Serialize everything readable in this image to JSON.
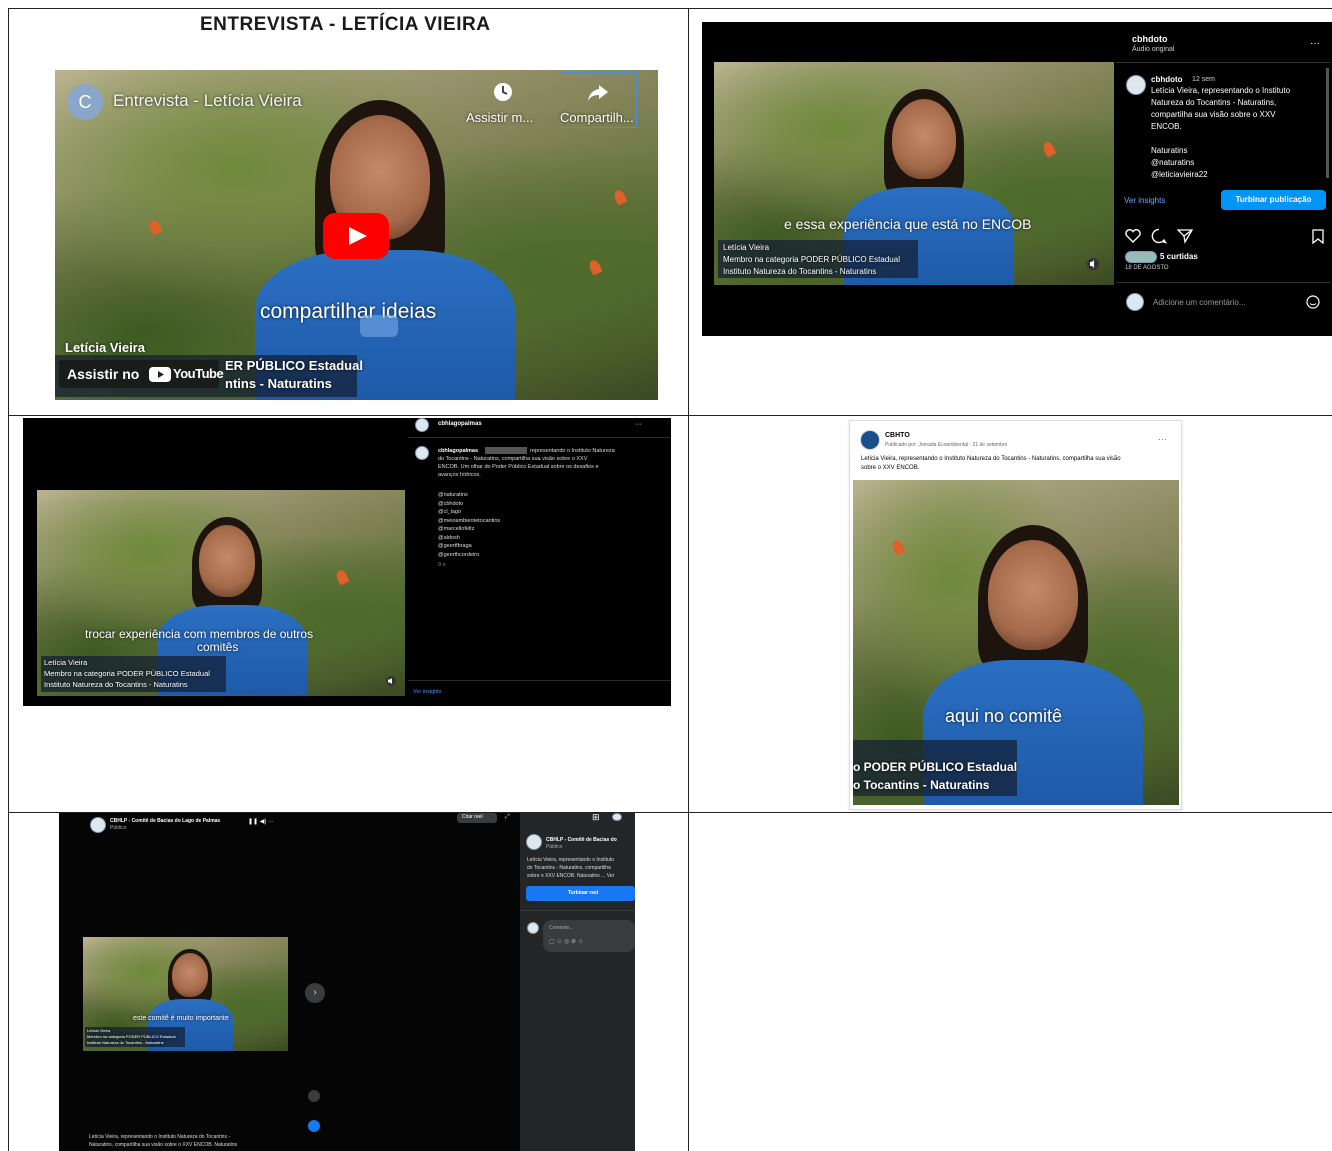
{
  "title": "ENTREVISTA - LETÍCIA VIEIRA",
  "youtube": {
    "channel_letter": "C",
    "video_title": "Entrevista - Letícia Vieira",
    "watch_later": "Assistir m...",
    "share": "Compartilh...",
    "caption": "compartilhar ideias",
    "watch_on": "Assistir no",
    "youtube_brand": "YouTube",
    "lower_name": "Letícia Vieira",
    "lower_line2": "ER PÚBLICO Estadual",
    "lower_line3": "ntins - Naturatins"
  },
  "instagram": {
    "username": "cbhdoto",
    "audio": "Áudio original",
    "more": "···",
    "post_user": "cbhdoto",
    "post_time": "12 sem",
    "post_text_1": "Letícia Vieira, representando o Instituto",
    "post_text_2": "Natureza do Tocantins - Naturatins,",
    "post_text_3": "compartilha sua visão sobre o XXV",
    "post_text_4": "ENCOB.",
    "tag_1": "Naturatins",
    "tag_2": "@naturatins",
    "tag_3": "@leticiavieira22",
    "insights": "Ver insights",
    "boost": "Turbinar publicação",
    "likes": "5 curtidas",
    "date": "18 DE AGOSTO",
    "comment_placeholder": "Adicione um comentário...",
    "caption": "e essa experiência que está no ENCOB",
    "lower_name": "Letícia Vieira",
    "lower_line2": "Membro na categoria PODER PÚBLICO Estadual",
    "lower_line3": "Instituto Natureza do Tocantins - Naturatins"
  },
  "instagram2": {
    "username": "cbhlagopalmas",
    "more": "···",
    "post_user": "cbhlagopalmas",
    "post_text_1": "representando o Instituto Natureza",
    "post_text_2": "do Tocantins - Naturatins, compartilha sua visão sobre o XXV",
    "post_text_3": "ENCOB. Um olhar do Poder Público Estadual sobre os desafios e",
    "post_text_4": "avanços hídricos.",
    "tags": [
      "@naturatins",
      "@cbhdoto",
      "@cl_lago",
      "@meioambientetocantins",
      "@marcellofeltz",
      "@aldosh",
      "@geertfbraga",
      "@geerthcordeiro"
    ],
    "time": "9 s",
    "insights": "Ver insights",
    "caption_1": "trocar experiência com membros de outros",
    "caption_2": "comitês",
    "lower_name": "Letícia Vieira",
    "lower_line2": "Membro na categoria PODER PÚBLICO Estadual",
    "lower_line3": "Instituto Natureza do Tocantins - Naturatins"
  },
  "facebook": {
    "page": "CBHTO",
    "meta": "Publicado por: Jornada Ecoambiental · 21 de setembro",
    "more": "···",
    "text_1": "Letícia Vieira, representando o Instituto Natureza do Tocantins - Naturatins, compartilha sua visão",
    "text_2": "sobre o XXV ENCOB.",
    "caption": "aqui no comitê",
    "lower_line2": "o PODER PÚBLICO Estadual",
    "lower_line3": "o Tocantins - Naturatins"
  },
  "reel": {
    "page": "CBHLP - Comitê de Bacias do Lago de Palmas",
    "privacy": "Público",
    "create": "Criar reel",
    "side_page": "CBHLP - Comitê de Bacias do",
    "side_privacy": "Público",
    "side_text_1": "Letícia Vieira, representando o Instituto",
    "side_text_2": "do Tocantins - Naturatins, compartilha",
    "side_text_3": "sobre o XXV ENCOB. Naturatins ... Ver",
    "boost": "Turbinar reel",
    "comment_placeholder": "Comente...",
    "caption": "este comitê é muito importante",
    "bottom_text_1": "Letícia Vieira, representando o Instituto Natureza do Tocantins -",
    "bottom_text_2": "Naturatins, compartilha sua visão sobre o XXV ENCOB. Naturatins",
    "lower_name": "Letícia Vieira",
    "lower_line2": "Membro na categoria PODER PÚBLICO Estadual",
    "lower_line3": "Instituto Natureza do Tocantins - Naturatins"
  },
  "colors": {
    "youtube_red": "#ff0000",
    "instagram_blue": "#0095f6",
    "facebook_blue": "#1877f2",
    "shirt_blue": "#1e5aa8"
  }
}
